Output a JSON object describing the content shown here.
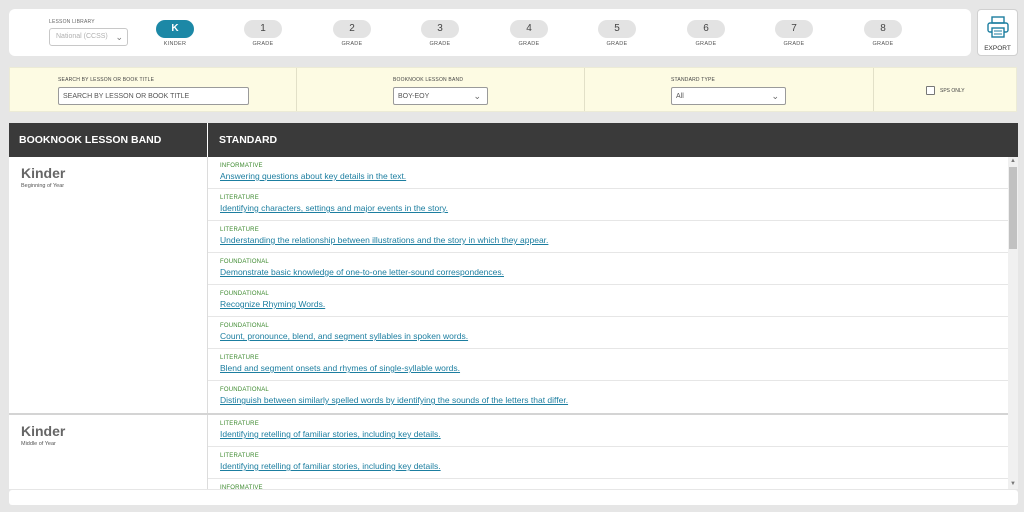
{
  "library": {
    "label": "LESSON LIBRARY",
    "placeholder": "National (CCSS)"
  },
  "grades": [
    {
      "value": "K",
      "label": "KINDER",
      "active": true
    },
    {
      "value": "1",
      "label": "GRADE"
    },
    {
      "value": "2",
      "label": "GRADE"
    },
    {
      "value": "3",
      "label": "GRADE"
    },
    {
      "value": "4",
      "label": "GRADE"
    },
    {
      "value": "5",
      "label": "GRADE"
    },
    {
      "value": "6",
      "label": "GRADE"
    },
    {
      "value": "7",
      "label": "GRADE"
    },
    {
      "value": "8",
      "label": "GRADE"
    }
  ],
  "export": {
    "label": "EXPORT"
  },
  "filters": {
    "search_label": "SEARCH BY LESSON OR BOOK TITLE",
    "search_placeholder": "SEARCH BY LESSON OR BOOK TITLE",
    "band_label": "BOOKNOOK LESSON BAND",
    "band_value": "BOY-EOY",
    "type_label": "STANDARD TYPE",
    "type_value": "All",
    "sps_label": "SPS ONLY"
  },
  "table": {
    "col_band": "BOOKNOOK LESSON BAND",
    "col_standard": "STANDARD",
    "groups": [
      {
        "band": "Kinder",
        "period": "Beginning of Year",
        "standards": [
          {
            "type": "INFORMATIVE",
            "text": "Answering questions about key details in the text."
          },
          {
            "type": "LITERATURE",
            "text": "Identifying characters, settings and major events in the story."
          },
          {
            "type": "LITERATURE",
            "text": "Understanding the relationship between illustrations and the story in which they appear."
          },
          {
            "type": "FOUNDATIONAL",
            "text": "Demonstrate basic knowledge of one-to-one letter-sound correspondences."
          },
          {
            "type": "FOUNDATIONAL",
            "text": "Recognize Rhyming Words."
          },
          {
            "type": "FOUNDATIONAL",
            "text": "Count, pronounce, blend, and segment syllables in spoken words."
          },
          {
            "type": "LITERATURE",
            "text": "Blend and segment onsets and rhymes of single-syllable words."
          },
          {
            "type": "FOUNDATIONAL",
            "text": "Distinguish between similarly spelled words by identifying the sounds of the letters that differ."
          }
        ]
      },
      {
        "band": "Kinder",
        "period": "Middle of Year",
        "standards": [
          {
            "type": "LITERATURE",
            "text": "Identifying retelling of familiar stories, including key details."
          },
          {
            "type": "LITERATURE",
            "text": "Identifying retelling of familiar stories, including key details."
          },
          {
            "type": "INFORMATIVE",
            "text": ""
          }
        ]
      }
    ]
  }
}
